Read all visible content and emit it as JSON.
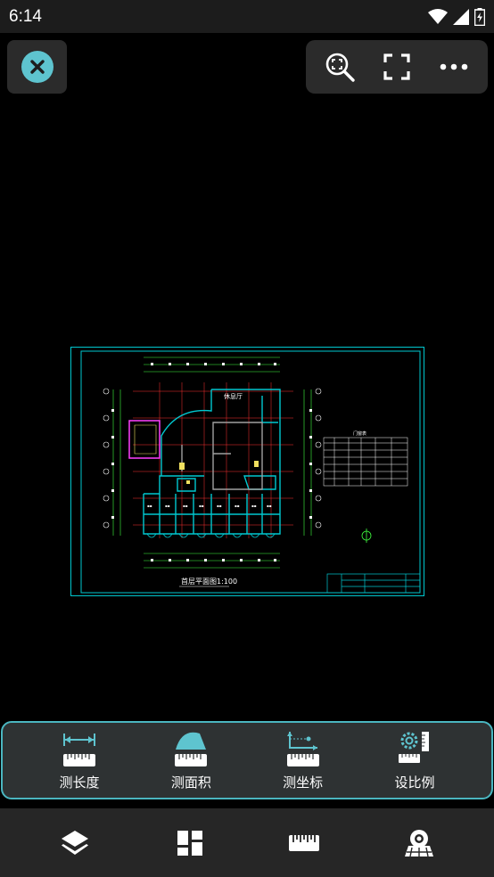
{
  "status_bar": {
    "time": "6:14",
    "icons": [
      "wifi-icon",
      "signal-icon",
      "battery-charging-icon"
    ]
  },
  "top_left": {
    "close_icon": "close-icon"
  },
  "top_toolbar": {
    "items": [
      "zoom-fit-icon",
      "fullscreen-icon",
      "more-options-icon"
    ]
  },
  "drawing": {
    "title": "首层平面图1:100",
    "room_label": "休息厅",
    "table_title": "门窗表"
  },
  "measure_tools": [
    {
      "label": "测长度",
      "icon": "measure-length-icon"
    },
    {
      "label": "测面积",
      "icon": "measure-area-icon"
    },
    {
      "label": "测坐标",
      "icon": "measure-coordinate-icon"
    },
    {
      "label": "设比例",
      "icon": "set-scale-icon"
    }
  ],
  "bottom_nav": {
    "items": [
      "layers-icon",
      "layout-icon",
      "ruler-icon",
      "view-icon"
    ]
  },
  "colors": {
    "accent": "#5ec4cf",
    "panel_border": "#4ab6c0",
    "cad_cyan": "#00c8d0",
    "cad_red": "#ff3030",
    "cad_yellow": "#f0e060",
    "cad_magenta": "#ff40ff",
    "cad_green": "#40ff40"
  }
}
